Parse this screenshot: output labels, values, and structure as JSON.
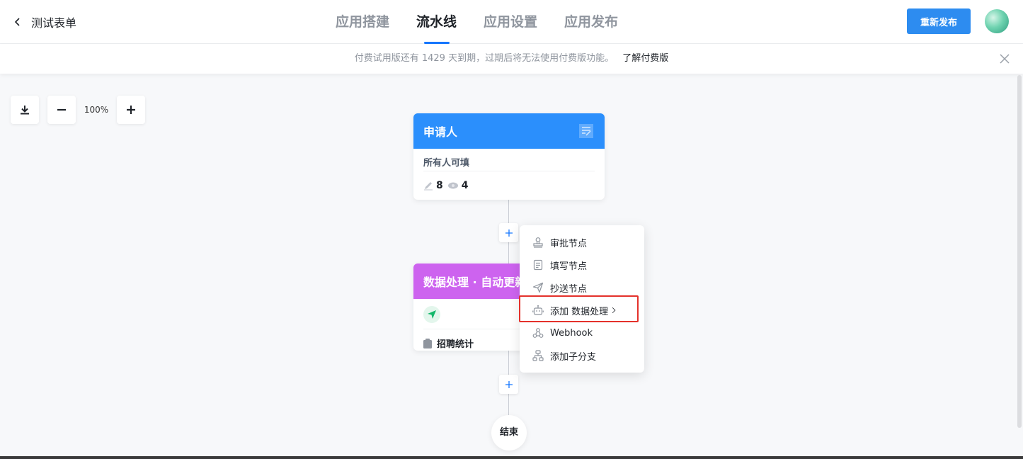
{
  "header": {
    "back_label": "测试表单",
    "tabs": [
      {
        "label": "应用搭建",
        "active": false
      },
      {
        "label": "流水线",
        "active": true
      },
      {
        "label": "应用设置",
        "active": false
      },
      {
        "label": "应用发布",
        "active": false
      }
    ],
    "publish_label": "重新发布"
  },
  "notice": {
    "message": "付费试用版还有 1429 天到期，过期后将无法使用付费版功能。",
    "link": "了解付费版"
  },
  "toolbar": {
    "zoom_level": "100%",
    "icons": [
      "download-icon",
      "zoom-out-icon",
      "zoom-in-icon"
    ]
  },
  "flow": {
    "applicant_node": {
      "title": "申请人",
      "subtitle": "所有人可填",
      "edit_count": "8",
      "view_count": "4",
      "color": "#2b8ffc"
    },
    "data_node": {
      "title": "数据处理 · 自动更新",
      "target": "招聘统计",
      "color": "#cd63ef"
    },
    "end_label": "结束"
  },
  "menu": {
    "items": [
      {
        "label": "审批节点",
        "icon": "stamp-icon"
      },
      {
        "label": "填写节点",
        "icon": "form-icon"
      },
      {
        "label": "抄送节点",
        "icon": "send-icon"
      },
      {
        "label": "添加 数据处理",
        "icon": "robot-icon",
        "has_submenu": true
      },
      {
        "label": "Webhook",
        "icon": "webhook-icon"
      },
      {
        "label": "添加子分支",
        "icon": "branch-icon"
      }
    ]
  },
  "colors": {
    "accent": "#1677ff",
    "publish": "#2d8cf0",
    "highlight": "#e4312b"
  }
}
